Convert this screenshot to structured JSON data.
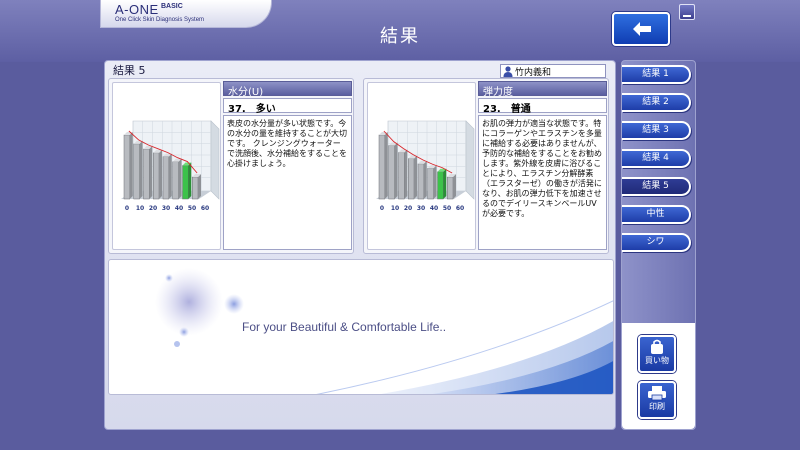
{
  "header": {
    "logo_main": "A-ONE",
    "logo_sub": "BASIC",
    "logo_tagline": "One Click Skin Diagnosis System",
    "title": "結果"
  },
  "main": {
    "results_label": "結果 5",
    "user_name": "竹内義和",
    "cards": [
      {
        "title": "水分(U)",
        "score": "37.　多い",
        "description": "表皮の水分量が多い状態です。今の水分の量を維持することが大切です。 クレンジングウォーターで洗顔後、水分補給をすることを心掛けましょう。",
        "chart": {
          "type": "bar",
          "x_ticks": [
            "0",
            "10",
            "20",
            "30",
            "40",
            "50",
            "60"
          ],
          "y_ticks": [
            "57",
            "47",
            "37",
            "24"
          ],
          "values": [
            57,
            50,
            46,
            43,
            40,
            36,
            33,
            24
          ],
          "highlight_index": 6
        }
      },
      {
        "title": "弾力度",
        "score": "23.　普通",
        "description": "お肌の弾力が適当な状態です。特にコラーゲンやエラスチンを多量に補給する必要はありませんが、予防的な補給をすることをお勧めします。紫外線を皮膚に浴びることにより、エラスチン分解酵素（エラスターゼ）の働きが活発になり、お肌の弾力低下を加速させるのでデイリースキンベールUVが必要です。",
        "chart": {
          "type": "bar",
          "x_ticks": [
            "0",
            "10",
            "20",
            "30",
            "40",
            "50",
            "60"
          ],
          "y_ticks": [
            "75",
            "55",
            "45",
            "35",
            "25"
          ],
          "values": [
            75,
            63,
            55,
            48,
            42,
            37,
            33,
            27
          ],
          "highlight_index": 6
        }
      }
    ],
    "banner_text": "For your Beautiful & Comfortable Life.."
  },
  "sidebar": {
    "tabs": [
      "結果 1",
      "結果 2",
      "結果 3",
      "結果 4",
      "結果 5",
      "中性",
      "シワ"
    ],
    "active_tab": 4,
    "buy_label": "買い物",
    "print_label": "印刷"
  },
  "colors": {
    "background": "#5a5c9e",
    "tab_blue": "#2a4fc0",
    "highlight_bar": "#3cc24a",
    "trend_line": "#d9262b"
  }
}
